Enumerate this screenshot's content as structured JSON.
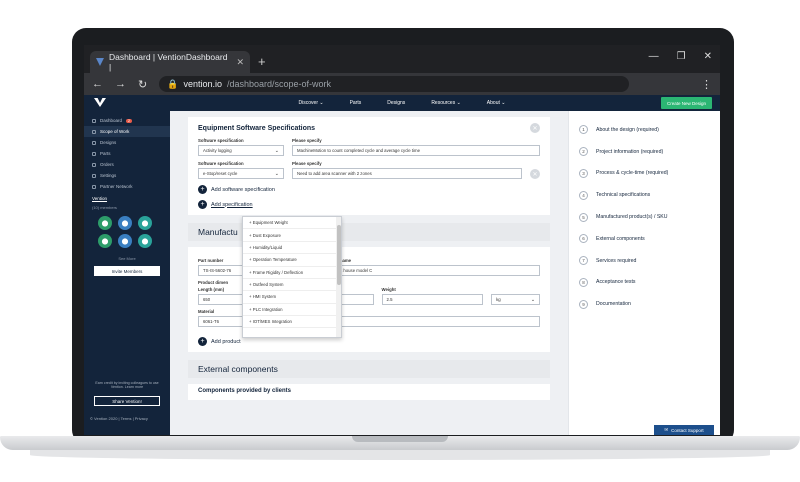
{
  "browser": {
    "tab_title": "Dashboard | VentionDashboard |",
    "url_host": "vention.io",
    "url_path": "/dashboard/scope-of-work"
  },
  "topnav": {
    "items": [
      "Discover ⌄",
      "Parts",
      "Designs",
      "Resources ⌄",
      "About ⌄"
    ],
    "create_button": "Create New Design"
  },
  "sidebar": {
    "items": [
      {
        "label": "Dashboard",
        "badge": "2"
      },
      {
        "label": "Scope of Work"
      },
      {
        "label": "Designs"
      },
      {
        "label": "Parts"
      },
      {
        "label": "Orders"
      },
      {
        "label": "Settings"
      },
      {
        "label": "Partner Network"
      }
    ],
    "team_name": "Vention",
    "members": "(10) members",
    "see_more": "See More",
    "invite_button": "Invite Members",
    "earn_text": "Earn credit by inviting colleagues to use Vention. Learn more",
    "share_button": "Share Vention!",
    "footer": "© Vention 2020 | Terms | Privacy"
  },
  "software": {
    "title": "Equipment Software Specifications",
    "spec_label": "Software specification",
    "specify_label": "Please specify",
    "row1_value": "Activity logging",
    "row1_specify": "MachineMotion to count completed cycle and average cycle time",
    "row2_value": "e-Stop/reset cycle",
    "row2_specify": "Need to add area scanner with 2 zones",
    "add_software": "Add software specification",
    "add_spec": "Add specification"
  },
  "dropdown": {
    "options": [
      "Equipment Weight",
      "Dust Exposure",
      "Humidity/Liquid",
      "Operation Temperature",
      "Frame Rigidity / Deflection",
      "Outfeed System",
      "HMI System",
      "PLC Integration",
      "IOT/MES Integration"
    ]
  },
  "manufactured": {
    "title": "Manufactu",
    "part_number_label": "Part number",
    "part_number": "TS-IS-5602-76",
    "name_label": "d name",
    "name_value": "t house model C",
    "dims_label": "Product dimen",
    "length_label": "Length (mm)",
    "length": "650",
    "mm_label": "(mm)",
    "weight_label": "Weight",
    "weight": "2.5",
    "unit": "kg",
    "material_label": "Material",
    "material": "6061-T6",
    "add_product": "Add product"
  },
  "external": {
    "title": "External components",
    "subtitle": "Components provided by clients"
  },
  "steps": [
    {
      "n": "1",
      "label": "About the design (required)"
    },
    {
      "n": "2",
      "label": "Project information (required)"
    },
    {
      "n": "3",
      "label": "Process & cycle-time (required)"
    },
    {
      "n": "4",
      "label": "Technical specifications"
    },
    {
      "n": "5",
      "label": "Manufactured product(s) / SKU"
    },
    {
      "n": "6",
      "label": "External components"
    },
    {
      "n": "7",
      "label": "Services required"
    },
    {
      "n": "8",
      "label": "Acceptance tests"
    },
    {
      "n": "9",
      "label": "Documentation"
    }
  ],
  "contact_support": "Contact Support",
  "colors": {
    "navy": "#13243b",
    "green": "#2bb673",
    "badge": "#e85c4a"
  }
}
